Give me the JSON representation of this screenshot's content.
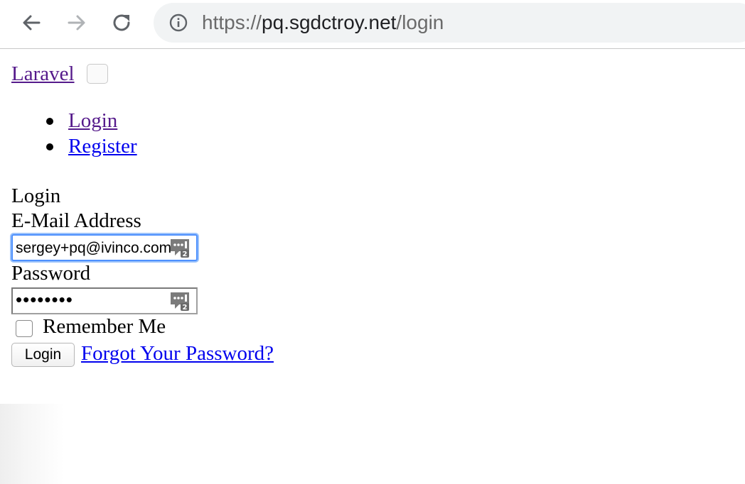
{
  "browser": {
    "back_icon": "arrow-left-icon",
    "forward_icon": "arrow-right-icon",
    "reload_icon": "reload-icon",
    "info_icon": "info-icon",
    "url": {
      "scheme": "https://",
      "host": "pq.sgdctroy.net",
      "path": "/login"
    }
  },
  "navbar": {
    "brand": "Laravel",
    "links": [
      {
        "label": "Login"
      },
      {
        "label": "Register"
      }
    ]
  },
  "form": {
    "title": "Login",
    "email_label": "E-Mail Address",
    "email_value": "sergey+pq@ivinco.com",
    "password_label": "Password",
    "password_mask": "••••••••",
    "password_manager_icon": "keypass-icon",
    "remember_label": "Remember Me",
    "remember_checked": false,
    "submit_label": "Login",
    "forgot_label": "Forgot Your Password?"
  },
  "colors": {
    "visited_link": "#551a8b",
    "link": "#0000ee",
    "focus_ring": "#4d90fe"
  }
}
